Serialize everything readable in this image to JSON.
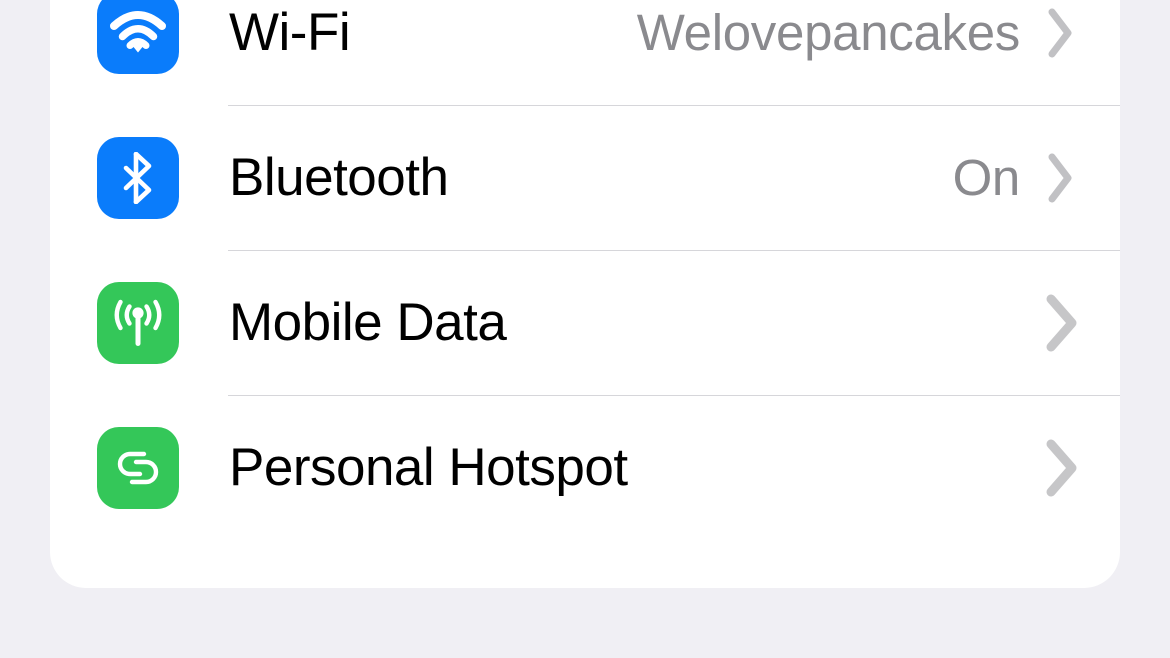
{
  "theme": {
    "page_background": "#f0eff4",
    "card_background": "#ffffff",
    "separator_color": "#d6d6da",
    "label_color": "#000000",
    "value_color": "#8a8a8e",
    "chevron_color": "#c6c6c8",
    "accent_blue": "#0a7cfb",
    "accent_green": "#34c759"
  },
  "settings": {
    "rows": [
      {
        "id": "wifi",
        "label": "Wi-Fi",
        "value": "Welovepancakes",
        "icon": "wifi-icon",
        "icon_color": "#0a7cfb",
        "has_chevron": true,
        "chevron_size": "small"
      },
      {
        "id": "bluetooth",
        "label": "Bluetooth",
        "value": "On",
        "icon": "bluetooth-icon",
        "icon_color": "#0a7cfb",
        "has_chevron": true,
        "chevron_size": "small"
      },
      {
        "id": "mobile-data",
        "label": "Mobile Data",
        "value": "",
        "icon": "antenna-broadcast-icon",
        "icon_color": "#34c759",
        "has_chevron": true,
        "chevron_size": "large"
      },
      {
        "id": "personal-hotspot",
        "label": "Personal Hotspot",
        "value": "",
        "icon": "chain-link-icon",
        "icon_color": "#34c759",
        "has_chevron": true,
        "chevron_size": "large"
      }
    ]
  }
}
